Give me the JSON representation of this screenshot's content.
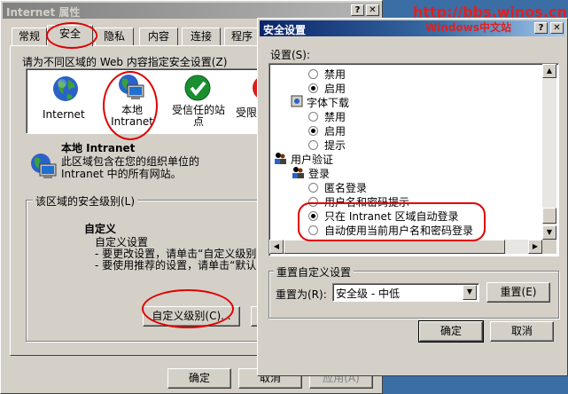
{
  "left_window": {
    "title": "Internet 属性",
    "title_buttons": {
      "help": "?",
      "close": "✕"
    },
    "tabs": [
      "常规",
      "安全",
      "隐私",
      "内容",
      "连接",
      "程序"
    ],
    "selected_tab": "安全",
    "zone_prompt": "请为不同区域的 Web 内容指定安全设置(Z)",
    "zones": [
      {
        "label": "Internet",
        "icon": "globe-icon"
      },
      {
        "label": "本地\nIntranet",
        "icon": "intranet-computer-icon"
      },
      {
        "label": "受信任的站\n点",
        "icon": "trusted-check-icon"
      },
      {
        "label": "受限",
        "icon": "restricted-icon"
      }
    ],
    "zone_info_title": "本地 Intranet",
    "zone_info_desc_1": "此区域包含在您的组织单位的",
    "zone_info_desc_2": "Intranet 中的所有网站。",
    "security_level_group": "该区域的安全级别(L)",
    "custom_title": "自定义",
    "custom_line_1": "自定义设置",
    "custom_line_2": "- 要更改设置，请单击“自定义级别",
    "custom_line_3": "- 要使用推荐的设置，请单击“默认",
    "custom_level_button": "自定义级别(C)...",
    "ok_button": "确定",
    "cancel_button": "取消",
    "apply_button": "应用(A)"
  },
  "right_window": {
    "title": "安全设置",
    "title_buttons": {
      "help": "?",
      "close": "✕"
    },
    "settings_label": "设置(S):",
    "tree": [
      {
        "type": "radio",
        "label": "禁用",
        "checked": false,
        "indent": 1
      },
      {
        "type": "radio",
        "label": "启用",
        "checked": true,
        "indent": 1
      },
      {
        "type": "node",
        "label": "字体下载",
        "icon": "settings-node-icon",
        "indent": 0
      },
      {
        "type": "radio",
        "label": "禁用",
        "checked": false,
        "indent": 1
      },
      {
        "type": "radio",
        "label": "启用",
        "checked": true,
        "indent": 1
      },
      {
        "type": "radio",
        "label": "提示",
        "checked": false,
        "indent": 1
      },
      {
        "type": "node",
        "label": "用户验证",
        "icon": "user-auth-icon",
        "indent": -1
      },
      {
        "type": "node",
        "label": "登录",
        "icon": "user-auth-icon",
        "indent": 0
      },
      {
        "type": "radio",
        "label": "匿名登录",
        "checked": false,
        "indent": 1
      },
      {
        "type": "radio",
        "label": "用户名和密码提示",
        "checked": false,
        "indent": 1
      },
      {
        "type": "radio",
        "label": "只在 Intranet 区域自动登录",
        "checked": true,
        "indent": 1
      },
      {
        "type": "radio",
        "label": "自动使用当前用户名和密码登录",
        "checked": false,
        "indent": 1
      }
    ],
    "reset_group": "重置自定义设置",
    "reset_to_label": "重置为(R):",
    "reset_select_value": "安全级 - 中低",
    "reset_button": "重置(E)",
    "ok_button": "确定",
    "cancel_button": "取消"
  },
  "watermark": {
    "line1": "http://bbs.winos.cn",
    "line2": "Windows中文站"
  },
  "colors": {
    "desktop": "#3a6ea5",
    "annotation_red": "#e00000",
    "watermark_red": "#e02020"
  }
}
